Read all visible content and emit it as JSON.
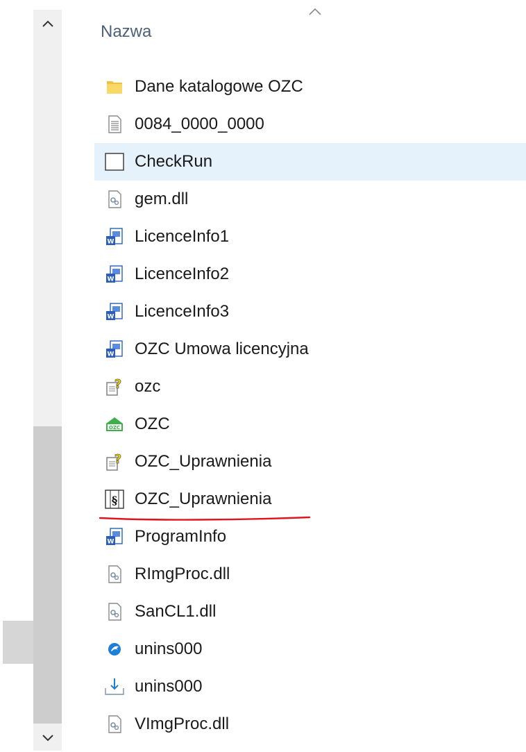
{
  "header": {
    "column_name": "Nazwa"
  },
  "files": [
    {
      "name": "Dane katalogowe OZC",
      "icon": "folder-icon"
    },
    {
      "name": "0084_0000_0000",
      "icon": "text-document-icon"
    },
    {
      "name": "CheckRun",
      "icon": "blank-file-icon",
      "selected": true
    },
    {
      "name": "gem.dll",
      "icon": "dll-settings-icon"
    },
    {
      "name": "LicenceInfo1",
      "icon": "word-document-icon"
    },
    {
      "name": "LicenceInfo2",
      "icon": "word-document-icon"
    },
    {
      "name": "LicenceInfo3",
      "icon": "word-document-icon"
    },
    {
      "name": "OZC Umowa licencyjna",
      "icon": "word-document-icon"
    },
    {
      "name": "ozc",
      "icon": "help-file-icon"
    },
    {
      "name": "OZC",
      "icon": "ozc-app-icon"
    },
    {
      "name": "OZC_Uprawnienia",
      "icon": "help-file-icon"
    },
    {
      "name": "OZC_Uprawnienia",
      "icon": "paragraph-document-icon",
      "underlined": true
    },
    {
      "name": "ProgramInfo",
      "icon": "word-document-icon"
    },
    {
      "name": "RImgProc.dll",
      "icon": "dll-settings-icon"
    },
    {
      "name": "SanCL1.dll",
      "icon": "dll-settings-icon"
    },
    {
      "name": "unins000",
      "icon": "uninstaller-icon"
    },
    {
      "name": "unins000",
      "icon": "install-download-icon"
    },
    {
      "name": "VImgProc.dll",
      "icon": "dll-settings-icon"
    }
  ],
  "colors": {
    "selection": "#e5f1fb",
    "header_text": "#4c607a",
    "annotation": "#e0141e",
    "folder": "#f0c23b",
    "word_blue": "#2b5eb8"
  }
}
